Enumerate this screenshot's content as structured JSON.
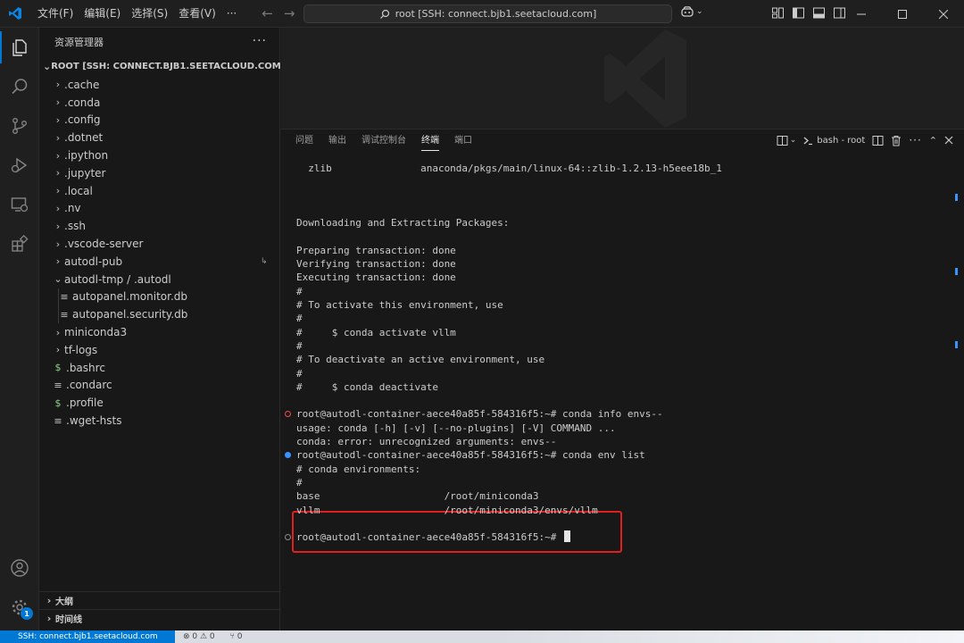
{
  "titlebar": {
    "menus": [
      "文件(F)",
      "编辑(E)",
      "选择(S)",
      "查看(V)",
      "···"
    ],
    "search_text": "root [SSH: connect.bjb1.seetacloud.com]"
  },
  "explorer": {
    "title": "资源管理器",
    "more": "···",
    "root_label": "ROOT [SSH: CONNECT.BJB1.SEETACLOUD.COM]",
    "items": [
      {
        "label": ".cache",
        "type": "folder"
      },
      {
        "label": ".conda",
        "type": "folder"
      },
      {
        "label": ".config",
        "type": "folder"
      },
      {
        "label": ".dotnet",
        "type": "folder"
      },
      {
        "label": ".ipython",
        "type": "folder"
      },
      {
        "label": ".jupyter",
        "type": "folder"
      },
      {
        "label": ".local",
        "type": "folder"
      },
      {
        "label": ".nv",
        "type": "folder"
      },
      {
        "label": ".ssh",
        "type": "folder"
      },
      {
        "label": ".vscode-server",
        "type": "folder"
      },
      {
        "label": "autodl-pub",
        "type": "folder"
      },
      {
        "label": "autodl-tmp / .autodl",
        "type": "folder-open"
      },
      {
        "label": "autopanel.monitor.db",
        "type": "file-db"
      },
      {
        "label": "autopanel.security.db",
        "type": "file-db"
      },
      {
        "label": "miniconda3",
        "type": "folder"
      },
      {
        "label": "tf-logs",
        "type": "folder"
      },
      {
        "label": ".bashrc",
        "type": "file-shell"
      },
      {
        "label": ".condarc",
        "type": "file-text"
      },
      {
        "label": ".profile",
        "type": "file-shell"
      },
      {
        "label": ".wget-hsts",
        "type": "file-text"
      }
    ],
    "outline_label": "大纲",
    "timeline_label": "时间线"
  },
  "panel": {
    "tabs": [
      "问题",
      "输出",
      "调试控制台",
      "终端",
      "端口"
    ],
    "active_tab": "终端",
    "terminal_name": "bash - root"
  },
  "terminal": {
    "lines": [
      {
        "text": "  zlib               anaconda/pkgs/main/linux-64::zlib-1.2.13-h5eee18b_1",
        "row": 0
      },
      {
        "text": "Downloading and Extracting Packages:",
        "row": 4
      },
      {
        "text": "Preparing transaction: done",
        "row": 6
      },
      {
        "text": "Verifying transaction: done",
        "row": 7
      },
      {
        "text": "Executing transaction: done",
        "row": 8
      },
      {
        "text": "#",
        "row": 9
      },
      {
        "text": "# To activate this environment, use",
        "row": 10
      },
      {
        "text": "#",
        "row": 11
      },
      {
        "text": "#     $ conda activate vllm",
        "row": 12
      },
      {
        "text": "#",
        "row": 13
      },
      {
        "text": "# To deactivate an active environment, use",
        "row": 14
      },
      {
        "text": "#",
        "row": 15
      },
      {
        "text": "#     $ conda deactivate",
        "row": 16
      },
      {
        "text": "root@autodl-container-aece40a85f-584316f5:~# conda info envs--",
        "row": 18,
        "dot": "err"
      },
      {
        "text": "usage: conda [-h] [-v] [--no-plugins] [-V] COMMAND ...",
        "row": 19
      },
      {
        "text": "conda: error: unrecognized arguments: envs--",
        "row": 20
      },
      {
        "text": "root@autodl-container-aece40a85f-584316f5:~# conda env list",
        "row": 21,
        "dot": "ok"
      },
      {
        "text": "# conda environments:",
        "row": 22
      },
      {
        "text": "#",
        "row": 23
      },
      {
        "text": "base                     /root/miniconda3",
        "row": 24
      },
      {
        "text": "vllm                     /root/miniconda3/envs/vllm",
        "row": 25
      },
      {
        "text": "root@autodl-container-aece40a85f-584316f5:~# ",
        "row": 27,
        "dot": "idle",
        "cursor": true
      }
    ]
  },
  "status": {
    "remote": "SSH: connect.bjb1.seetacloud.com",
    "problems": "⊗ 0 ⚠ 0",
    "ports": "⑂ 0"
  },
  "accent_color": "#0078d4",
  "settings_badge": "1"
}
